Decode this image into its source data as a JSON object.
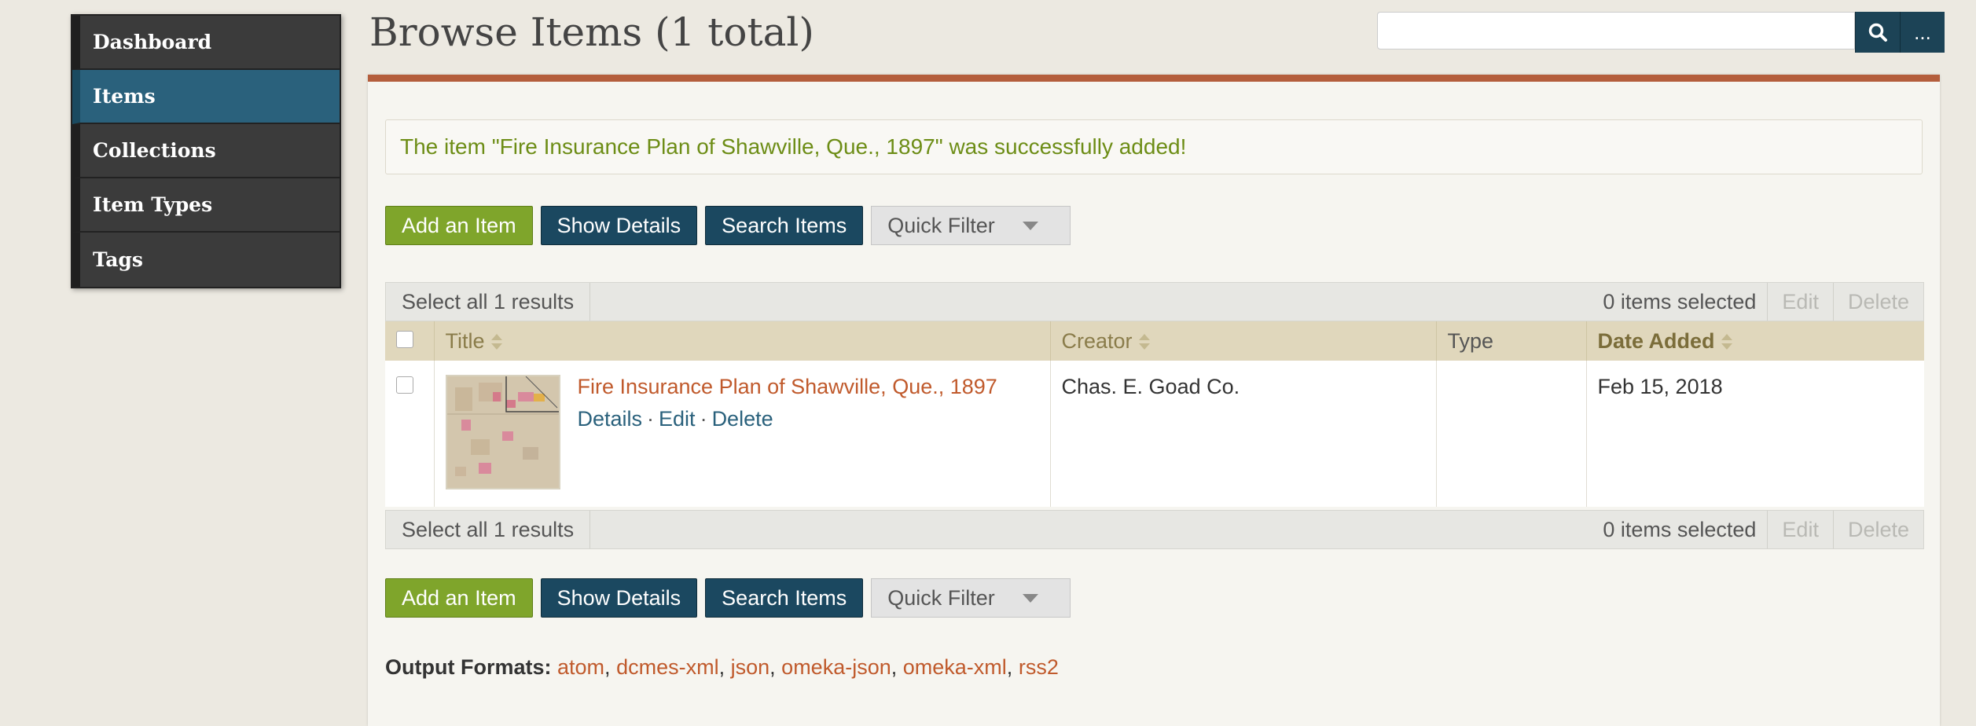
{
  "sidebar": {
    "items": [
      {
        "label": "Dashboard",
        "active": false
      },
      {
        "label": "Items",
        "active": true
      },
      {
        "label": "Collections",
        "active": false
      },
      {
        "label": "Item Types",
        "active": false
      },
      {
        "label": "Tags",
        "active": false
      }
    ]
  },
  "page_title": "Browse Items (1 total)",
  "search": {
    "placeholder": "",
    "search_icon": "search-icon",
    "options_label": "..."
  },
  "flash_message": "The item \"Fire Insurance Plan of Shawville, Que., 1897\" was successfully added!",
  "actions": {
    "add_item": "Add an Item",
    "show_details": "Show Details",
    "search_items": "Search Items",
    "quick_filter": "Quick Filter"
  },
  "batch": {
    "select_all": "Select all 1 results",
    "selected_count": "0 items selected",
    "edit": "Edit",
    "delete": "Delete"
  },
  "table": {
    "columns": {
      "title": "Title",
      "creator": "Creator",
      "type": "Type",
      "date_added": "Date Added"
    },
    "rows": [
      {
        "title": "Fire Insurance Plan of Shawville, Que., 1897",
        "details": "Details",
        "edit": "Edit",
        "delete": "Delete",
        "separator": "·",
        "creator": "Chas. E. Goad Co.",
        "type": "",
        "date_added": "Feb 15, 2018"
      }
    ]
  },
  "output_formats": {
    "label": "Output Formats:",
    "formats": [
      "atom",
      "dcmes-xml",
      "json",
      "omeka-json",
      "omeka-xml",
      "rss2"
    ],
    "separator": ","
  },
  "colors": {
    "accent_active": "#2a617c",
    "link_orange": "#c05a2c",
    "success_green": "#6d8d16",
    "button_green": "#7fa52b",
    "button_dark": "#1b4860"
  }
}
